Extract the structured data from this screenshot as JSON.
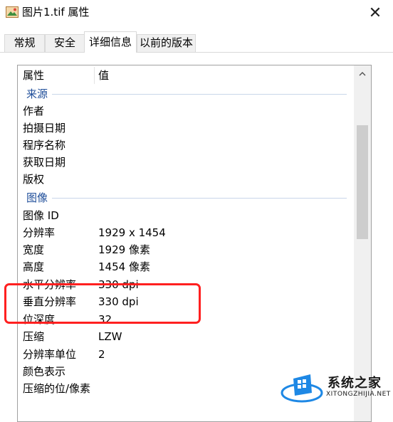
{
  "window": {
    "title": "图片1.tif 属性",
    "icon": "image-file-icon",
    "close_glyph": "✕"
  },
  "tabs": [
    {
      "label": "常规",
      "active": false
    },
    {
      "label": "安全",
      "active": false
    },
    {
      "label": "详细信息",
      "active": true
    },
    {
      "label": "以前的版本",
      "active": false
    }
  ],
  "details": {
    "columns": [
      "属性",
      "值"
    ],
    "sections": [
      {
        "group": "来源",
        "rows": [
          {
            "name": "作者",
            "value": ""
          },
          {
            "name": "拍摄日期",
            "value": ""
          },
          {
            "name": "程序名称",
            "value": ""
          },
          {
            "name": "获取日期",
            "value": ""
          },
          {
            "name": "版权",
            "value": ""
          }
        ]
      },
      {
        "group": "图像",
        "rows": [
          {
            "name": "图像 ID",
            "value": ""
          },
          {
            "name": "分辨率",
            "value": "1929 x 1454"
          },
          {
            "name": "宽度",
            "value": "1929 像素"
          },
          {
            "name": "高度",
            "value": "1454 像素"
          },
          {
            "name": "水平分辨率",
            "value": "330 dpi"
          },
          {
            "name": "垂直分辨率",
            "value": "330 dpi"
          },
          {
            "name": "位深度",
            "value": "32"
          },
          {
            "name": "压缩",
            "value": "LZW"
          },
          {
            "name": "分辨率单位",
            "value": "2"
          },
          {
            "name": "颜色表示",
            "value": ""
          },
          {
            "name": "压缩的位/像素",
            "value": ""
          }
        ]
      }
    ]
  },
  "watermark": {
    "brand": "系统之家",
    "site": "XITONGZHIJIA.NET"
  },
  "colors": {
    "highlight": "#ff2020",
    "group_text": "#1f4e9a",
    "logo_blue": "#1e88e5"
  }
}
